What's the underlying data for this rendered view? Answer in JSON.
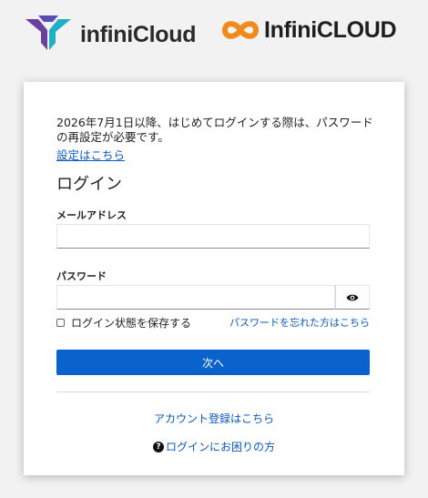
{
  "logos": {
    "left_brand": "infiniCloud",
    "right_brand": "InfiniCLOUD",
    "left_mark_colors": [
      "#6b3fa0",
      "#1fb0c8"
    ],
    "right_mark_color": "#f08a1c"
  },
  "notice": {
    "text": "2026年7月1日以降、はじめてログインする際は、パスワードの再設定が必要です。",
    "link": "設定はこちら"
  },
  "form": {
    "heading": "ログイン",
    "email_label": "メールアドレス",
    "email_value": "",
    "password_label": "パスワード",
    "password_value": "",
    "show_password_icon": "eye-icon",
    "remember_label": "ログイン状態を保存する",
    "remember_checked": false,
    "forgot_link": "パスワードを忘れた方はこちら",
    "next_button": "次へ"
  },
  "footer": {
    "register_link": "アカウント登録はこちら",
    "help_icon": "question-circle-icon",
    "help_link": "ログインにお困りの方"
  },
  "colors": {
    "primary": "#0a63cc",
    "link": "#0a58c4",
    "background": "#f2f2f2"
  }
}
